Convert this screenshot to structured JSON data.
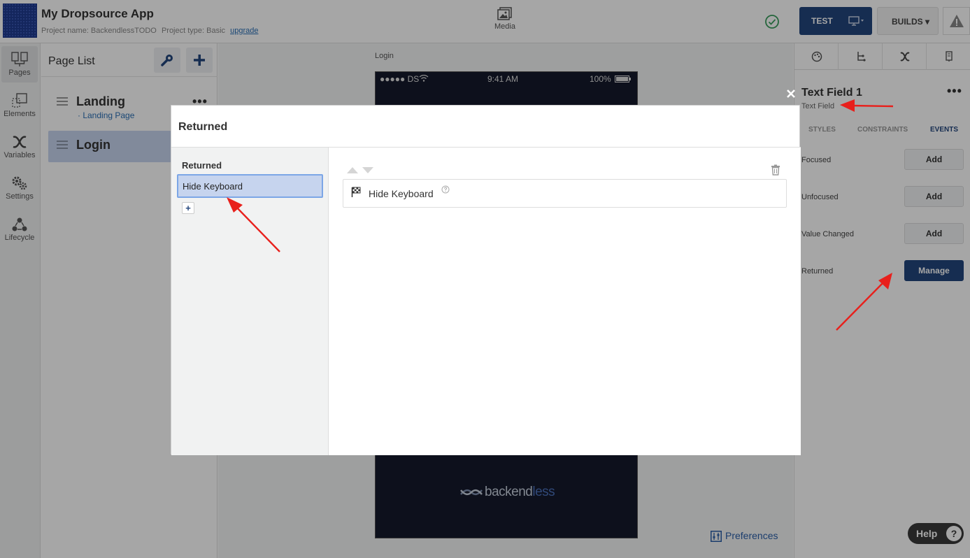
{
  "header": {
    "app_title": "My Dropsource App",
    "project_name_label": "Project name: BackendlessTODO",
    "project_type_label": "Project type: Basic",
    "upgrade_link": "upgrade",
    "media_label": "Media",
    "test_label": "TEST",
    "builds_label": "BUILDS ▾"
  },
  "rail": {
    "items": [
      {
        "label": "Pages",
        "icon": "pages-icon"
      },
      {
        "label": "Elements",
        "icon": "elements-icon"
      },
      {
        "label": "Variables",
        "icon": "variables-icon"
      },
      {
        "label": "Settings",
        "icon": "settings-icon"
      },
      {
        "label": "Lifecycle",
        "icon": "lifecycle-icon"
      }
    ]
  },
  "page_list": {
    "title": "Page List",
    "pages": [
      {
        "name": "Landing",
        "subtitle": "· Landing Page",
        "menu": "•••"
      },
      {
        "name": "Login",
        "subtitle": "",
        "menu": ""
      }
    ]
  },
  "canvas": {
    "page_label": "Login",
    "status_carrier": "●●●●● DS",
    "status_time": "9:41 AM",
    "status_battery": "100%",
    "brand_main": "backend",
    "brand_light": "less",
    "preferences_label": "Preferences"
  },
  "inspector": {
    "component_title": "Text Field 1",
    "component_type": "Text Field",
    "menu": "•••",
    "subtabs": [
      "STYLES",
      "CONSTRAINTS",
      "EVENTS"
    ],
    "events": [
      {
        "label": "Focused",
        "button": "Add"
      },
      {
        "label": "Unfocused",
        "button": "Add"
      },
      {
        "label": "Value Changed",
        "button": "Add"
      },
      {
        "label": "Returned",
        "button": "Manage"
      }
    ],
    "help_label": "Help",
    "help_glyph": "?"
  },
  "modal": {
    "title": "Returned",
    "left_title": "Returned",
    "selected_item": "Hide Keyboard",
    "add_glyph": "+",
    "close_glyph": "✕",
    "action_label": "Hide Keyboard"
  },
  "colors": {
    "primary": "#23467d",
    "selection": "#c6d4ee",
    "annotation": "#e8201c",
    "success": "#3a9d5d"
  }
}
